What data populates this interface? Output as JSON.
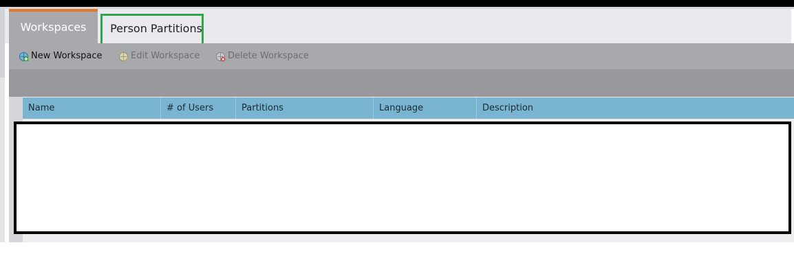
{
  "tabs": [
    {
      "label": "Workspaces",
      "active": true
    },
    {
      "label": "Person Partitions",
      "active": false,
      "highlighted": true
    }
  ],
  "toolbar": {
    "new_label": "New Workspace",
    "edit_label": "Edit Workspace",
    "delete_label": "Delete Workspace"
  },
  "table": {
    "columns": [
      "Name",
      "# of Users",
      "Partitions",
      "Language",
      "Description"
    ],
    "rows": []
  },
  "colors": {
    "accent_orange": "#e07b2e",
    "highlight_green": "#2fa64b",
    "header_blue": "#79b4d0"
  }
}
